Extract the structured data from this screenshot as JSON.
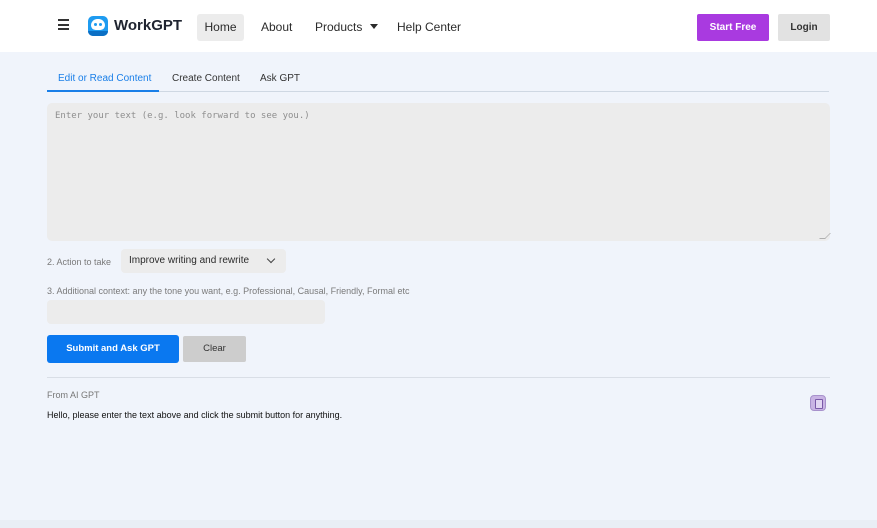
{
  "header": {
    "brand": "WorkGPT",
    "nav": [
      "Home",
      "About",
      "Products",
      "Help Center"
    ],
    "start_free": "Start Free",
    "login": "Login"
  },
  "tabs": [
    "Edit or Read Content",
    "Create Content",
    "Ask GPT"
  ],
  "editor": {
    "placeholder": "Enter your text (e.g. look forward to see you.)",
    "value": ""
  },
  "action": {
    "label": "2. Action to take",
    "selected": "Improve writing and rewrite"
  },
  "context": {
    "label": "3. Additional context: any the tone you want, e.g. Professional, Causal, Friendly, Formal etc",
    "value": ""
  },
  "buttons": {
    "submit": "Submit and Ask GPT",
    "clear": "Clear"
  },
  "result": {
    "from_label": "From AI GPT",
    "text": "Hello, please enter the text above and click the submit button for anything."
  },
  "colors": {
    "accent_blue": "#0a78f0",
    "start_free_purple": "#a93ae0",
    "background": "#f0f4fb"
  }
}
